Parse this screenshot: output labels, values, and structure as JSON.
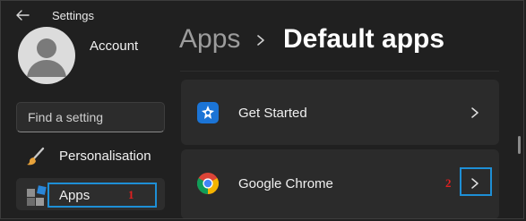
{
  "window": {
    "title": "Settings"
  },
  "account": {
    "name": "Account"
  },
  "search": {
    "placeholder": "Find a setting"
  },
  "sidebar": {
    "items": [
      {
        "label": "Personalisation",
        "icon": "paintbrush-icon"
      },
      {
        "label": "Apps",
        "icon": "apps-icon",
        "selected": true
      }
    ]
  },
  "breadcrumb": {
    "parent": "Apps",
    "current": "Default apps"
  },
  "apps": [
    {
      "name": "Get Started",
      "icon": "get-started-icon"
    },
    {
      "name": "Google Chrome",
      "icon": "chrome-icon"
    }
  ],
  "annotations": {
    "step1": "1",
    "step2": "2",
    "highlight_color": "#1e8fd6",
    "number_color": "#e02020"
  },
  "colors": {
    "background": "#202020",
    "card": "#2b2b2b",
    "accent": "#1e8fd6"
  }
}
